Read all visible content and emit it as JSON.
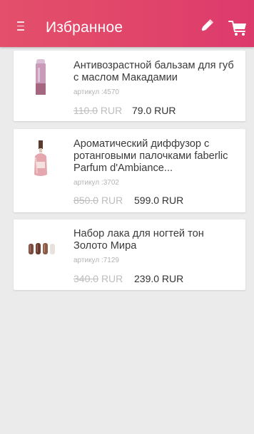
{
  "header": {
    "title": "Избранное",
    "menu_icon": "menu-icon",
    "edit_icon": "pencil-icon",
    "cart_icon": "cart-icon"
  },
  "items": [
    {
      "name": "Антивозрастной бальзам для губ с маслом Макадамии",
      "sku": "артикул :4570",
      "old_price": "110.0",
      "currency": "RUR",
      "new_price": "79.0 RUR"
    },
    {
      "name": "Ароматический диффузор с ротанговыми палочками faberlic Parfum d'Ambiance...",
      "sku": "артикул :3702",
      "old_price": "850.0",
      "currency": "RUR",
      "new_price": "599.0 RUR"
    },
    {
      "name": "Набор лака для ногтей тон Золото Мира",
      "sku": "артикул :7129",
      "old_price": "340.0",
      "currency": "RUR",
      "new_price": "239.0 RUR"
    }
  ],
  "colors": {
    "header_start": "#e3506a",
    "header_end": "#dd3a6c",
    "background": "#ebebeb"
  }
}
